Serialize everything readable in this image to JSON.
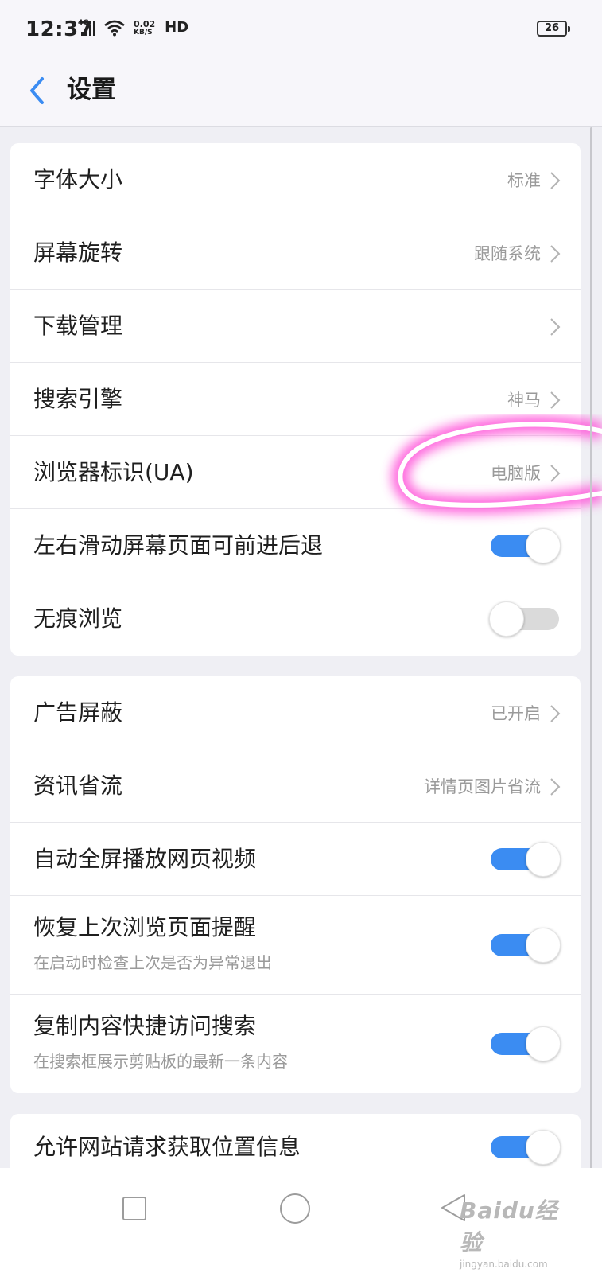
{
  "status_bar": {
    "time": "12:37",
    "signal_label": "4G",
    "net_speed_value": "0.02",
    "net_speed_unit": "KB/S",
    "hd_label": "HD",
    "battery": "26"
  },
  "header": {
    "title": "设置"
  },
  "groups": [
    {
      "items": [
        {
          "label": "字体大小",
          "value": "标准",
          "control": "chevron"
        },
        {
          "label": "屏幕旋转",
          "value": "跟随系统",
          "control": "chevron"
        },
        {
          "label": "下载管理",
          "value": "",
          "control": "chevron"
        },
        {
          "label": "搜索引擎",
          "value": "神马",
          "control": "chevron"
        },
        {
          "label": "浏览器标识(UA)",
          "value": "电脑版",
          "control": "chevron"
        },
        {
          "label": "左右滑动屏幕页面可前进后退",
          "control": "toggle",
          "on": true
        },
        {
          "label": "无痕浏览",
          "control": "toggle",
          "on": false
        }
      ]
    },
    {
      "items": [
        {
          "label": "广告屏蔽",
          "value": "已开启",
          "control": "chevron"
        },
        {
          "label": "资讯省流",
          "value": "详情页图片省流",
          "control": "chevron"
        },
        {
          "label": "自动全屏播放网页视频",
          "control": "toggle",
          "on": true
        },
        {
          "label": "恢复上次浏览页面提醒",
          "sub": "在启动时检查上次是否为异常退出",
          "control": "toggle",
          "on": true
        },
        {
          "label": "复制内容快捷访问搜索",
          "sub": "在搜索框展示剪贴板的最新一条内容",
          "control": "toggle",
          "on": true
        }
      ]
    },
    {
      "items": [
        {
          "label": "允许网站请求获取位置信息",
          "control": "toggle",
          "on": true
        }
      ]
    }
  ],
  "watermark": {
    "brand": "Baidu经验",
    "url": "jingyan.baidu.com"
  },
  "colors": {
    "accent": "#3b8cf2",
    "toggle_off": "#dadada",
    "annotation": "#ff4fd8",
    "background": "#efeff4"
  }
}
